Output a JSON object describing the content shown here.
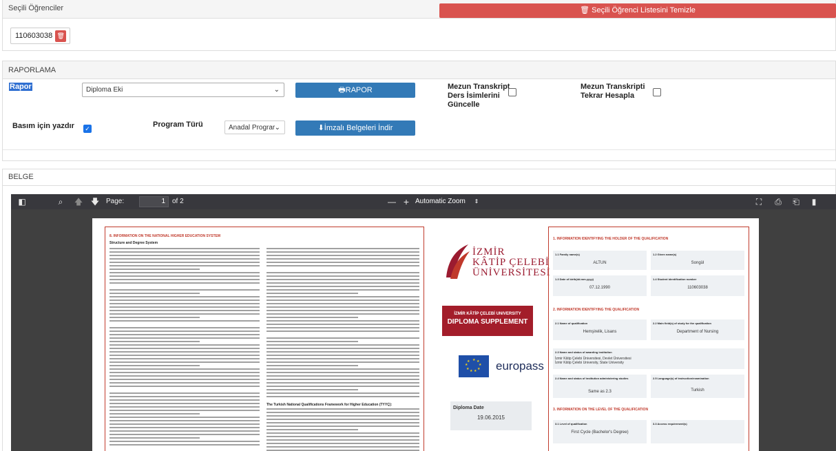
{
  "selected": {
    "title": "Seçili Öğrenciler",
    "clear_button": "Seçili Öğrenci Listesini Temizle",
    "clear_icon": "trash-icon",
    "student_number": "110603038"
  },
  "report": {
    "title": "RAPORLAMA",
    "rapor_label": "Rapor",
    "rapor_value": "Diploma Eki",
    "rapor_button": "RAPOR",
    "transcript_names_label": [
      "Mezun Transkript",
      "Ders İsimlerini",
      "Güncelle"
    ],
    "transcript_recalc_label": [
      "Mezun Transkripti",
      "Tekrar Hesapla"
    ],
    "print_label": "Basım için yazdır",
    "print_checked": true,
    "program_label": "Program Türü",
    "program_value": "Anadal Prograr",
    "download_button": "İmzalı Belgeleri İndir"
  },
  "belge": {
    "title": "BELGE",
    "viewer": {
      "page_label": "Page:",
      "page_number": "1",
      "page_total": "of 2",
      "zoom_label": "Automatic Zoom",
      "zoom_minus": "—",
      "zoom_plus": "+"
    },
    "doc": {
      "left_section_title": "8. INFORMATION ON THE NATIONAL HIGHER EDUCATION SYSTEM",
      "left_sub_title": "Structure and Degree System",
      "tqf_title": "The Turkish National Qualifications Framework for Higher Education (TYYÇ):",
      "logo_line1": "İZMİR",
      "logo_line2": "KÂTİP ÇELEBİ",
      "logo_line3": "ÜNİVERSİTESİ",
      "ds_subtitle": "İZMİR KÂTİP ÇELEBİ UNIVERSITY",
      "ds_title": "DIPLOMA SUPPLEMENT",
      "europass": "europass",
      "diploma_date_label": "Diploma Date",
      "diploma_date_value": "19.06.2015",
      "right_section1_title": "1. INFORMATION IDENTIFYING THE HOLDER OF THE QUALIFICATION",
      "family_name_label": "1.1 Family name(s)",
      "family_name": "ALTUN",
      "given_name_label": "1.2 Given name(s)",
      "given_name": "Songül",
      "dob_label": "1.3 Date of birth(dd.mm.yyyy)",
      "dob": "07.12.1990",
      "student_id_label": "1.4 Student identification number",
      "student_id": "110603038",
      "right_section2_title": "2. INFORMATION IDENTIFYING THE QUALIFICATION",
      "qual_name_label": "2.1 Name of qualification",
      "qual_name": "Hemşirelik, Lisans",
      "field_label": "2.2 Main field(s) of study for the qualification",
      "field": "Department of Nursing",
      "inst_label": "2.3 Name and status of awarding institution",
      "inst_line1": "İzmir Kâtip Çelebi Üniversitesi, Devlet Üniversitesi",
      "inst_line2": "İzmir Kâtip Çelebi University, State University",
      "admin_label": "2.4 Name and status of institution administering studies",
      "admin": "Same as 2.3",
      "lang_label": "2.5 Language(s) of instruction/examination",
      "lang": "Turkish",
      "right_section3_title": "3. INFORMATION ON THE LEVEL OF THE QUALIFICATION",
      "level_label": "3.1 Level of qualification",
      "level": "First Cycle (Bachelor's Degree)",
      "access_label": "3.3 Access requirement(s)"
    }
  }
}
